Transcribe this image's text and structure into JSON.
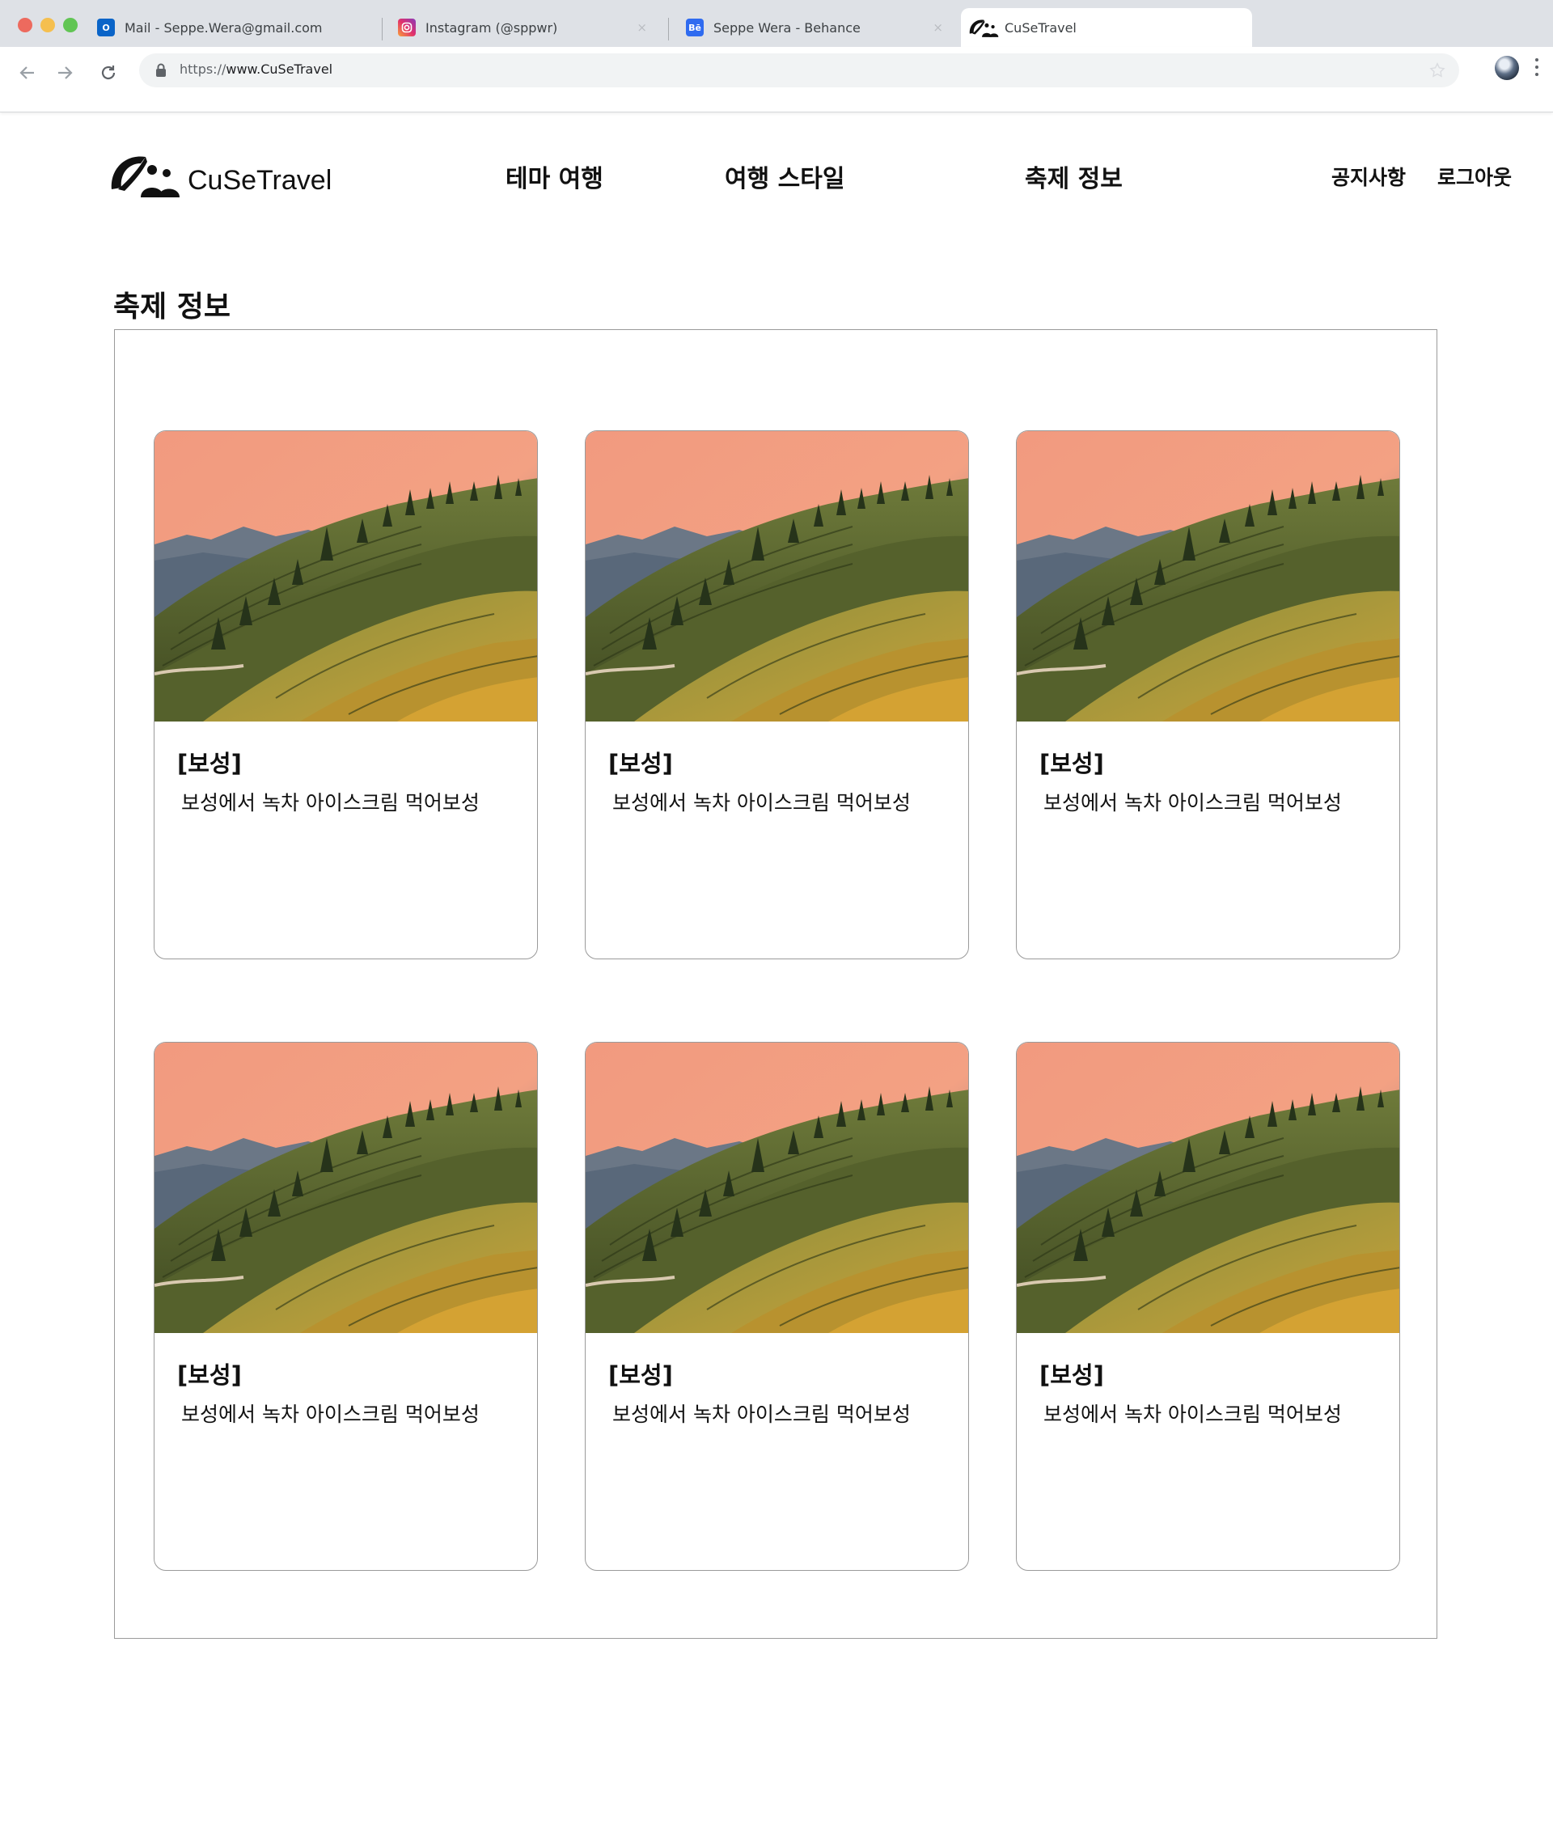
{
  "browser": {
    "tabs": [
      {
        "title": "Mail - Seppe.Wera@gmail.com",
        "icon": "outlook-icon",
        "active": false
      },
      {
        "title": "Instagram (@sppwr)",
        "icon": "instagram-icon",
        "active": false
      },
      {
        "title": "Seppe Wera - Behance",
        "icon": "behance-icon",
        "active": false
      },
      {
        "title": "CuSeTravel",
        "icon": "cusetravel-logo-icon",
        "active": true
      }
    ],
    "tab_close_glyph": "×",
    "favicon_text": {
      "outlook": "O",
      "behance": "Bē"
    },
    "address": {
      "scheme": "https://",
      "host": "www.CuSeTravel"
    },
    "colors": {
      "tabbar": "#dee1e6",
      "close": "#ed6a5e",
      "minimize": "#f5bf4f",
      "maximize": "#61c554"
    }
  },
  "site": {
    "logo_text": "CuSeTravel",
    "nav": [
      "테마 여행",
      "여행 스타일",
      "축제 정보"
    ],
    "utility": {
      "notice": "공지사항",
      "logout": "로그아웃"
    }
  },
  "main": {
    "section_title": "축제 정보",
    "cards": [
      {
        "tag": "[보성]",
        "description": "보성에서 녹차 아이스크림 먹어보성",
        "image": "tea-plantation-sunset"
      },
      {
        "tag": "[보성]",
        "description": "보성에서 녹차 아이스크림 먹어보성",
        "image": "tea-plantation-sunset"
      },
      {
        "tag": "[보성]",
        "description": "보성에서 녹차 아이스크림 먹어보성",
        "image": "tea-plantation-sunset"
      },
      {
        "tag": "[보성]",
        "description": "보성에서 녹차 아이스크림 먹어보성",
        "image": "tea-plantation-sunset"
      },
      {
        "tag": "[보성]",
        "description": "보성에서 녹차 아이스크림 먹어보성",
        "image": "tea-plantation-sunset"
      },
      {
        "tag": "[보성]",
        "description": "보성에서 녹차 아이스크림 먹어보성",
        "image": "tea-plantation-sunset"
      }
    ]
  }
}
